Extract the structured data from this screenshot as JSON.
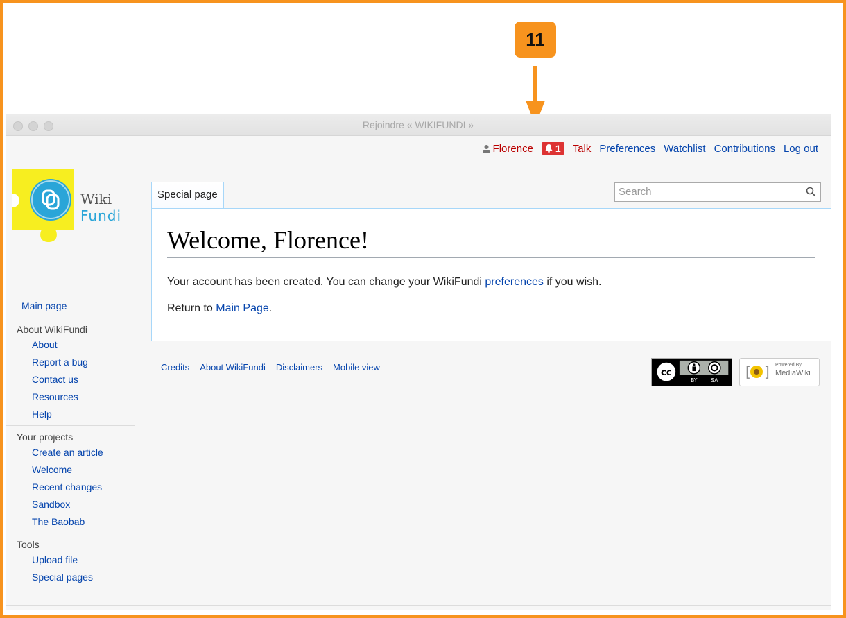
{
  "annotation": {
    "step_number": "11",
    "color": "#f7931e"
  },
  "window": {
    "title": "Rejoindre « WIKIFUNDI »"
  },
  "personal_bar": {
    "username": "Florence",
    "notification_count": "1",
    "talk": "Talk",
    "preferences": "Preferences",
    "watchlist": "Watchlist",
    "contributions": "Contributions",
    "logout": "Log out",
    "username_icon": "user-icon",
    "notification_icon": "bell-icon"
  },
  "logo": {
    "wiki": "Wiki",
    "fundi": "Fundi",
    "yellow": "#f7ee20",
    "blue": "#2aa5d8"
  },
  "sidebar": {
    "main_page": "Main page",
    "portals": [
      {
        "heading": "About WikiFundi",
        "items": [
          "About",
          "Report a bug",
          "Contact us",
          "Resources",
          "Help"
        ]
      },
      {
        "heading": "Your projects",
        "items": [
          "Create an article",
          "Welcome",
          "Recent changes",
          "Sandbox",
          "The Baobab"
        ]
      },
      {
        "heading": "Tools",
        "items": [
          "Upload file",
          "Special pages"
        ]
      }
    ]
  },
  "tabs": {
    "special_page": "Special page"
  },
  "search": {
    "placeholder": "Search"
  },
  "content": {
    "heading": "Welcome, Florence!",
    "line1_prefix": "Your account has been created. You can change your WikiFundi ",
    "line1_link": "preferences",
    "line1_suffix": " if you wish.",
    "line2_prefix": "Return to ",
    "line2_link": "Main Page",
    "line2_suffix": "."
  },
  "footer": {
    "links": [
      "Credits",
      "About WikiFundi",
      "Disclaimers",
      "Mobile view"
    ],
    "cc_badge": {
      "cc": "cc",
      "by": "BY",
      "sa": "SA"
    },
    "mw_badge": {
      "line1": "Powered By",
      "line2": "MediaWiki"
    }
  }
}
